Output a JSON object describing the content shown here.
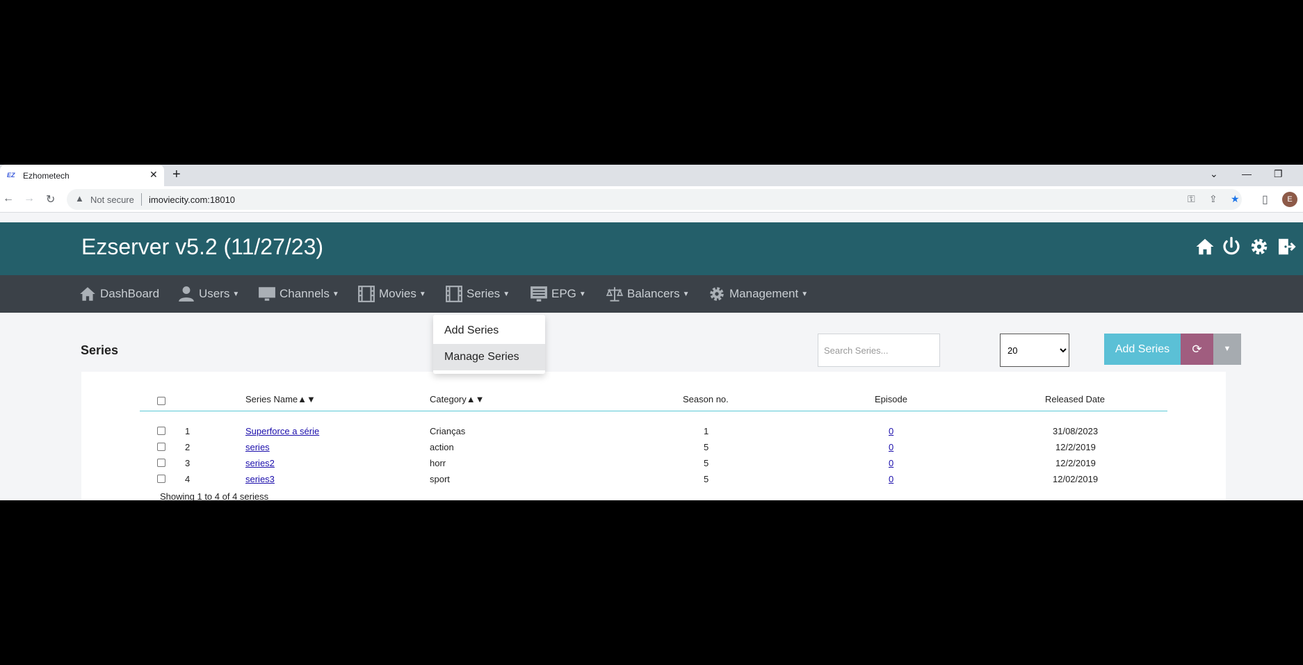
{
  "browser": {
    "tab_title": "Ezhometech",
    "favicon_text": "EZ",
    "security_label": "Not secure",
    "url": "imoviecity.com:18010",
    "avatar_letter": "E"
  },
  "app": {
    "title": "Ezserver v5.2 (11/27/23)"
  },
  "nav": {
    "items": [
      {
        "label": "DashBoard",
        "icon": "home-icon",
        "has_caret": false
      },
      {
        "label": "Users",
        "icon": "user-icon",
        "has_caret": true
      },
      {
        "label": "Channels",
        "icon": "monitor-icon",
        "has_caret": true
      },
      {
        "label": "Movies",
        "icon": "film-icon",
        "has_caret": true
      },
      {
        "label": "Series",
        "icon": "film-icon",
        "has_caret": true
      },
      {
        "label": "EPG",
        "icon": "epg-icon",
        "has_caret": true
      },
      {
        "label": "Balancers",
        "icon": "scale-icon",
        "has_caret": true
      },
      {
        "label": "Management",
        "icon": "gear-icon",
        "has_caret": true
      }
    ]
  },
  "dropdown": {
    "items": [
      "Add Series",
      "Manage Series"
    ]
  },
  "page": {
    "title": "Series",
    "search_placeholder": "Search Series...",
    "per_page": "20",
    "add_button": "Add Series",
    "sort_arrows": "▲▼"
  },
  "table": {
    "headers": {
      "name": "Series Name",
      "category": "Category",
      "season": "Season no.",
      "episode": "Episode",
      "released": "Released Date"
    },
    "rows": [
      {
        "num": "1",
        "name": "Superforce a série",
        "category": "Crianças",
        "season": "1",
        "episode": "0",
        "released": "31/08/2023"
      },
      {
        "num": "2",
        "name": "series",
        "category": "action",
        "season": "5",
        "episode": "0",
        "released": "12/2/2019"
      },
      {
        "num": "3",
        "name": "series2",
        "category": "horr",
        "season": "5",
        "episode": "0",
        "released": "12/2/2019"
      },
      {
        "num": "4",
        "name": "series3",
        "category": "sport",
        "season": "5",
        "episode": "0",
        "released": "12/02/2019"
      }
    ],
    "footer": "Showing 1 to 4 of 4 seriess"
  }
}
